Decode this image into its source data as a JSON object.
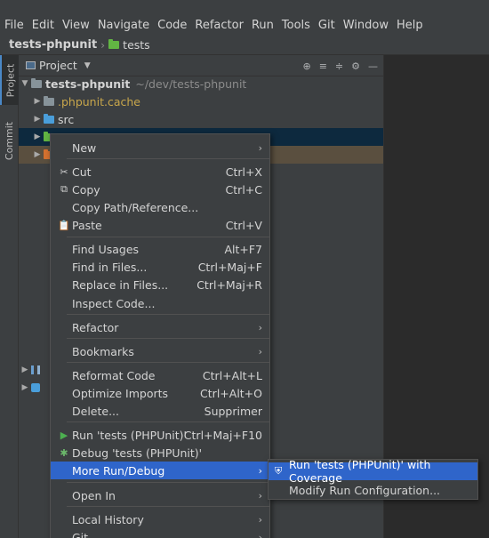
{
  "menubar": [
    "File",
    "Edit",
    "View",
    "Navigate",
    "Code",
    "Refactor",
    "Run",
    "Tools",
    "Git",
    "Window",
    "Help"
  ],
  "breadcrumb": {
    "project": "tests-phpunit",
    "folder": "tests"
  },
  "side_tabs": {
    "project": "Project",
    "commit": "Commit"
  },
  "panel": {
    "title": "Project",
    "caret": "▼",
    "tools": [
      "⊕",
      "≡",
      "≑",
      "⚙",
      "—"
    ]
  },
  "tree": {
    "root_name": "tests-phpunit",
    "root_path": "~/dev/tests-phpunit",
    "phpunit_cache": ".phpunit.cache",
    "src": "src"
  },
  "context_menu": {
    "items": [
      {
        "label": "New",
        "shortcut": "",
        "icon": "",
        "submenu": true
      },
      {
        "label": "Cut",
        "shortcut": "Ctrl+X",
        "icon": "✂",
        "submenu": false
      },
      {
        "label": "Copy",
        "shortcut": "Ctrl+C",
        "icon": "⧉",
        "submenu": false
      },
      {
        "label": "Copy Path/Reference...",
        "shortcut": "",
        "icon": "",
        "submenu": false
      },
      {
        "label": "Paste",
        "shortcut": "Ctrl+V",
        "icon": "📋",
        "submenu": false
      },
      {
        "label": "Find Usages",
        "shortcut": "Alt+F7",
        "icon": "",
        "submenu": false
      },
      {
        "label": "Find in Files...",
        "shortcut": "Ctrl+Maj+F",
        "icon": "",
        "submenu": false
      },
      {
        "label": "Replace in Files...",
        "shortcut": "Ctrl+Maj+R",
        "icon": "",
        "submenu": false
      },
      {
        "label": "Inspect Code...",
        "shortcut": "",
        "icon": "",
        "submenu": false
      },
      {
        "label": "Refactor",
        "shortcut": "",
        "icon": "",
        "submenu": true
      },
      {
        "label": "Bookmarks",
        "shortcut": "",
        "icon": "",
        "submenu": true
      },
      {
        "label": "Reformat Code",
        "shortcut": "Ctrl+Alt+L",
        "icon": "",
        "submenu": false
      },
      {
        "label": "Optimize Imports",
        "shortcut": "Ctrl+Alt+O",
        "icon": "",
        "submenu": false
      },
      {
        "label": "Delete...",
        "shortcut": "Supprimer",
        "icon": "",
        "submenu": false
      },
      {
        "label": "Run 'tests (PHPUnit)'",
        "shortcut": "Ctrl+Maj+F10",
        "icon": "▶",
        "submenu": false
      },
      {
        "label": "Debug 'tests (PHPUnit)'",
        "shortcut": "",
        "icon": "✱",
        "submenu": false
      },
      {
        "label": "More Run/Debug",
        "shortcut": "",
        "icon": "",
        "submenu": true
      },
      {
        "label": "Open In",
        "shortcut": "",
        "icon": "",
        "submenu": true
      },
      {
        "label": "Local History",
        "shortcut": "",
        "icon": "",
        "submenu": true
      },
      {
        "label": "Git",
        "shortcut": "",
        "icon": "",
        "submenu": true
      }
    ],
    "submenu_arrow": "›"
  },
  "submenu": {
    "items": [
      {
        "label": "Run 'tests (PHPUnit)' with Coverage",
        "icon": "⛨"
      },
      {
        "label": "Modify Run Configuration...",
        "icon": ""
      }
    ]
  },
  "colors": {
    "highlight": "#2f65ca",
    "panel": "#3c3f41",
    "editor": "#2b2b2b",
    "run_green": "#4caf50",
    "debug_green": "#6bb86b"
  }
}
